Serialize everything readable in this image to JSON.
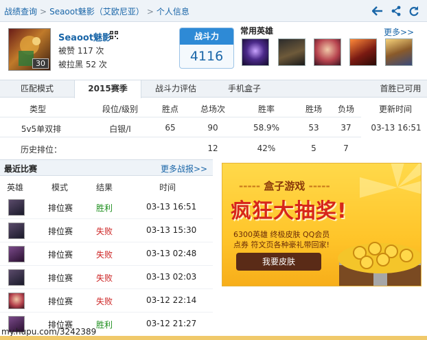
{
  "breadcrumb": [
    "战绩查询",
    "Seaoot魅影（艾欧尼亚）",
    "个人信息"
  ],
  "profile": {
    "level": "30",
    "name": "Seaoot魅影",
    "likes": "被赞 117 次",
    "blacklisted": "被拉黑 52 次"
  },
  "power": {
    "label": "战斗力",
    "value": "4116"
  },
  "frequent_heroes": {
    "title": "常用英雄",
    "more": "更多>>"
  },
  "tabs": [
    "匹配模式",
    "2015赛季",
    "战斗力评估",
    "手机盒子",
    "首胜已可用"
  ],
  "stats": {
    "headers": [
      "类型",
      "段位/级别",
      "胜点",
      "总场次",
      "胜率",
      "胜场",
      "负场",
      "更新时间"
    ],
    "row1": [
      "5v5单双排",
      "白银/I",
      "65",
      "90",
      "58.9%",
      "53",
      "37",
      "03-13 16:51"
    ],
    "row2": {
      "label": "历史排位：",
      "total": "12",
      "rate": "42%",
      "wins": "5",
      "losses": "7"
    }
  },
  "recent": {
    "title": "最近比赛",
    "more": "更多战报>>",
    "headers": [
      "英雄",
      "模式",
      "结果",
      "时间"
    ],
    "matches": [
      {
        "mode": "排位赛",
        "result": "胜利",
        "time": "03-13 16:51"
      },
      {
        "mode": "排位赛",
        "result": "失败",
        "time": "03-13 15:30"
      },
      {
        "mode": "排位赛",
        "result": "失败",
        "time": "03-13 02:48"
      },
      {
        "mode": "排位赛",
        "result": "失败",
        "time": "03-13 02:03"
      },
      {
        "mode": "排位赛",
        "result": "失败",
        "time": "03-12 22:14"
      },
      {
        "mode": "排位赛",
        "result": "胜利",
        "time": "03-12 21:27"
      }
    ]
  },
  "ad": {
    "title": "盒子游戏",
    "headline": "疯狂大抽奖!",
    "line1": "6300英雄 终极皮肤 QQ会员",
    "line2": "点券 符文页各种豪礼带回家!",
    "button": "我要皮肤"
  },
  "watermark": "my.hupu.com/3242389",
  "colors": {
    "win": "#1f8f1f",
    "loss": "#cc2222",
    "link": "#1a66a8",
    "accent": "#2e8ad6"
  }
}
